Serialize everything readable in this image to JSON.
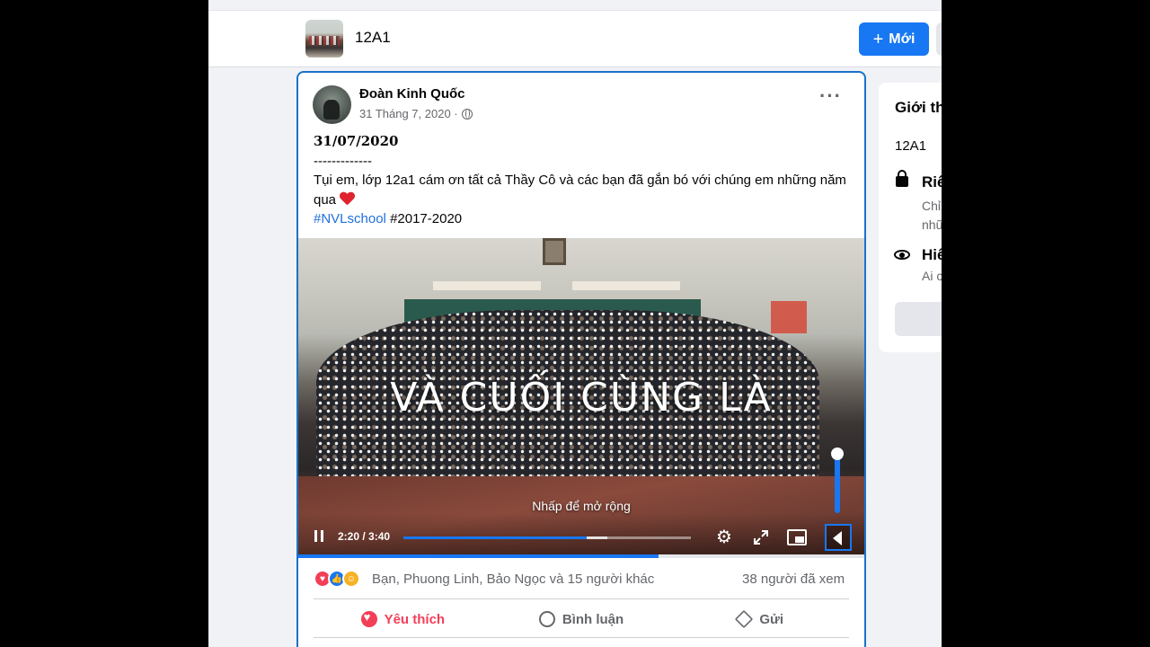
{
  "header": {
    "group_name": "12A1",
    "new_button_label": "Mới"
  },
  "post": {
    "author": "Đoàn Kinh Quốc",
    "date": "31 Tháng 7, 2020 ·",
    "body_date": "31/07/2020",
    "body_sep": "-------------",
    "body_text": "Tụi em, lớp 12a1 cám ơn tất cả Thầy Cô và các bạn đã gắn bó với chúng em những năm qua",
    "hashtag1": "#NVLschool",
    "hashtag2": "#2017-2020",
    "video": {
      "overlay_text": "VÀ CUỐI CÙNG LÀ",
      "expand_hint": "Nhấp để mở rộng",
      "time": "2:20 / 3:40",
      "progress": 0.636
    },
    "reactions_text": "Bạn, Phuong Linh, Bảo Ngọc và 15 người khác",
    "views": "38 người đã xem",
    "actions": {
      "like": "Yêu thích",
      "comment": "Bình luận",
      "share": "Gửi"
    }
  },
  "about": {
    "title": "Giới th",
    "name": "12A1",
    "privacy_title": "Riê",
    "privacy_sub1": "Chỉ",
    "privacy_sub2": "nhũ",
    "visible_title": "Hiể",
    "visible_sub": "Ai c"
  },
  "colors": {
    "accent": "#1877f2",
    "love": "#f33e58",
    "post_border": "#1a73c9"
  }
}
